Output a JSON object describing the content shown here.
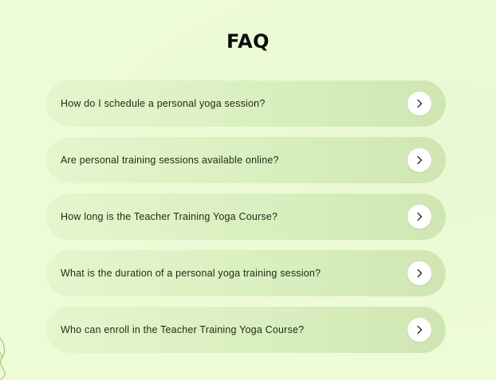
{
  "faq": {
    "title": "FAQ",
    "items": [
      {
        "question": "How do I schedule a personal yoga session?",
        "icon": "chevron-right-icon"
      },
      {
        "question": "Are personal training sessions available online?",
        "icon": "chevron-right-icon"
      },
      {
        "question": "How long is the Teacher Training Yoga Course?",
        "icon": "chevron-right-icon"
      },
      {
        "question": "What is the duration of a personal yoga training session?",
        "icon": "chevron-right-icon"
      },
      {
        "question": "Who can enroll in the Teacher Training Yoga Course?",
        "icon": "chevron-right-icon"
      }
    ]
  },
  "colors": {
    "background": "#eefbd7",
    "card_gradient_start": "#e6f5cd",
    "card_gradient_end": "#cfe6b3",
    "title_text": "#0c0c0c",
    "question_text": "#1f2a14",
    "arrow_button": "#ffffff",
    "decoration_line": "#9fc77a"
  },
  "decoration": {
    "icon": "leaf-outline-icon"
  }
}
